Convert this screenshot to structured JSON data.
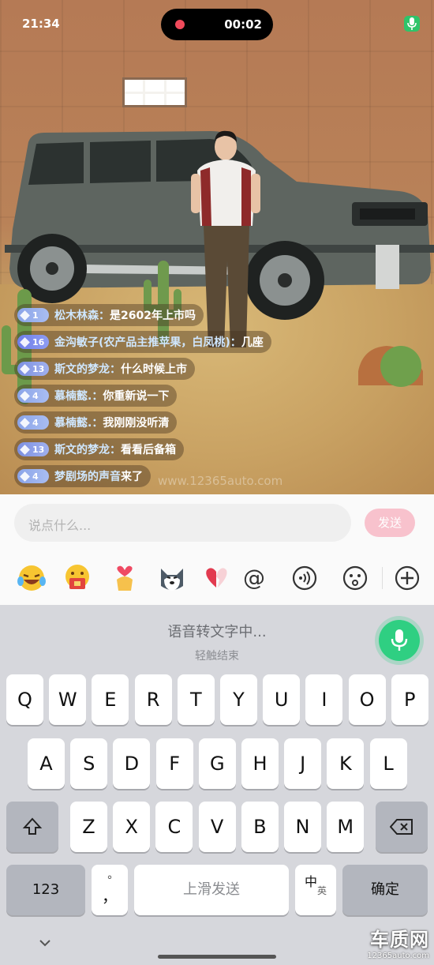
{
  "status_bar": {
    "time": "21:34",
    "recording_timer": "00:02"
  },
  "chat": [
    {
      "level": "1",
      "badge": "b-a",
      "user": "松木林森：",
      "text": "是2602年上市吗"
    },
    {
      "level": "16",
      "badge": "b-b",
      "user": "金沟敏子(农产品主推苹果，白凤桃)：",
      "text": "几座"
    },
    {
      "level": "13",
      "badge": "b-c",
      "user": "斯文的梦龙：",
      "text": "什么时候上市"
    },
    {
      "level": "4",
      "badge": "b-a",
      "user": "慕楠懿.：",
      "text": "你重新说一下"
    },
    {
      "level": "4",
      "badge": "b-a",
      "user": "慕楠懿.：",
      "text": "我刚刚没听清"
    },
    {
      "level": "13",
      "badge": "b-c",
      "user": "斯文的梦龙：",
      "text": "看看后备箱"
    },
    {
      "level": "4",
      "badge": "b-a",
      "user": "梦剧场的声音",
      "text": "来了"
    }
  ],
  "watermark": "www.12365auto.com",
  "input": {
    "placeholder": "说点什么...",
    "send_label": "发送"
  },
  "emoji_bar": [
    "laughing-crying-emoji",
    "gift-bag-emoji",
    "heart-hands-emoji",
    "husky-emoji",
    "broken-heart-emoji",
    "at-icon",
    "voice-wave-icon",
    "smiley-icon",
    "add-icon"
  ],
  "voice_input": {
    "status": "语音转文字中...",
    "hint": "轻触结束"
  },
  "keyboard": {
    "row1": [
      "Q",
      "W",
      "E",
      "R",
      "T",
      "Y",
      "U",
      "I",
      "O",
      "P"
    ],
    "row2": [
      "A",
      "S",
      "D",
      "F",
      "G",
      "H",
      "J",
      "K",
      "L"
    ],
    "row3": [
      "Z",
      "X",
      "C",
      "V",
      "B",
      "N",
      "M"
    ],
    "numbers_label": "123",
    "punct_top": "°",
    "punct_bottom": "，",
    "space_label": "上滑发送",
    "lang_cn": "中",
    "lang_en": "英",
    "confirm_label": "确定"
  },
  "brand": {
    "name": "车质网",
    "url": "12365auto.com"
  },
  "colors": {
    "send_disabled": "#f8c2cd",
    "voice_mic": "#2fcf82",
    "chat_name": "#cfe7ff",
    "rec_dot": "#f04a5b"
  }
}
